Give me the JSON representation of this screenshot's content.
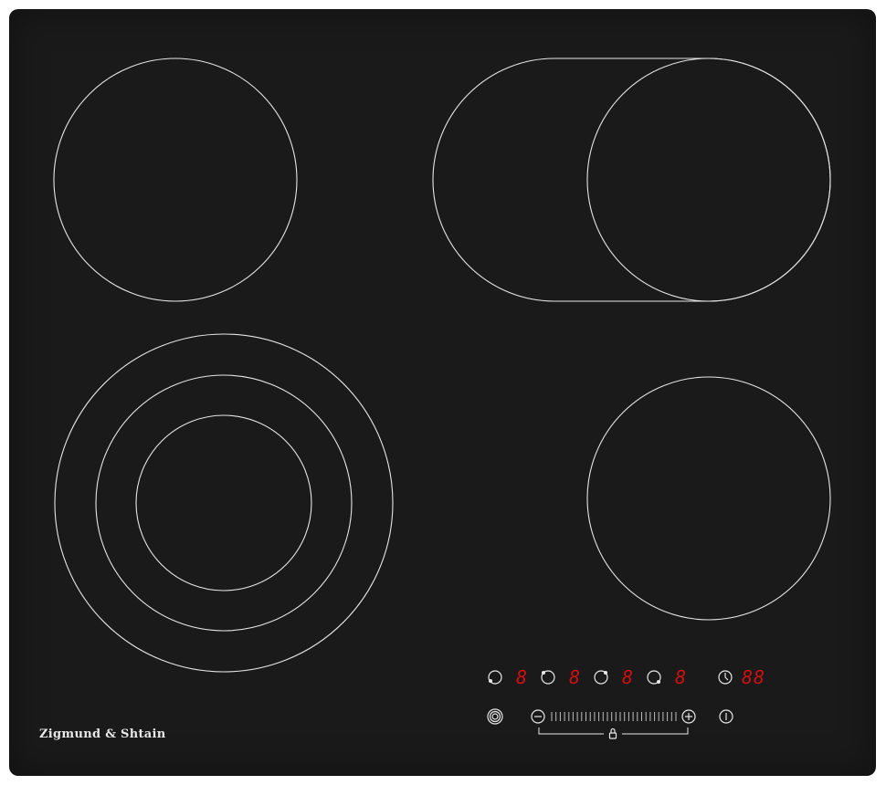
{
  "brand": {
    "logo_text": "Zigmund & Shtain"
  },
  "zones": [
    {
      "id": "rear-left",
      "type": "single"
    },
    {
      "id": "rear-right",
      "type": "oval-extended"
    },
    {
      "id": "front-left",
      "type": "triple-ring"
    },
    {
      "id": "front-right",
      "type": "single"
    }
  ],
  "controls": {
    "zone_displays": [
      "8",
      "8",
      "8",
      "8"
    ],
    "timer_display": "88",
    "icons": [
      "zone-select-rear-left-icon",
      "zone-select-rear-right-icon",
      "zone-select-front-right-icon",
      "zone-select-front-left-icon",
      "timer-clock-icon",
      "dual-zone-toggle-icon",
      "minus-icon",
      "plus-icon",
      "lock-icon",
      "power-icon"
    ]
  },
  "colors": {
    "glass": "#1a1a1b",
    "zone_outline": "#e0e0e0",
    "display_red": "#d01010",
    "icon_white": "#e8e8e8"
  }
}
